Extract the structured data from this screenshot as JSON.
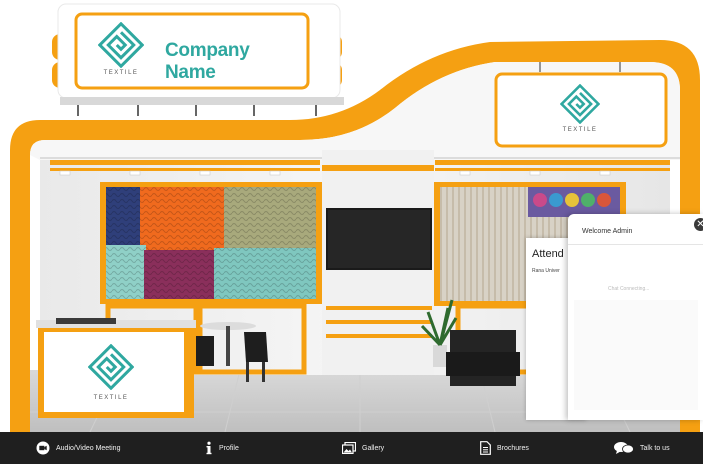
{
  "booth": {
    "company_name": "Company Name",
    "logo_caption": "TEXTILE"
  },
  "chat": {
    "header": "Welcome Admin",
    "connecting_text": "Chat Connecting...",
    "back_panel_title": "Attend",
    "back_panel_subtitle": "Rana Univer",
    "close_symbol": "✕"
  },
  "navbar": {
    "items": [
      {
        "label": "Audio/Video Meeting",
        "icon": "video-camera-icon"
      },
      {
        "label": "Profile",
        "icon": "info-icon"
      },
      {
        "label": "Gallery",
        "icon": "gallery-icon"
      },
      {
        "label": "Brochures",
        "icon": "document-icon"
      },
      {
        "label": "Talk to us",
        "icon": "chat-bubbles-icon"
      }
    ]
  },
  "colors": {
    "accent_orange": "#f5a012",
    "logo_teal": "#2fa8a0",
    "nav_bg": "#1f1f1f"
  }
}
